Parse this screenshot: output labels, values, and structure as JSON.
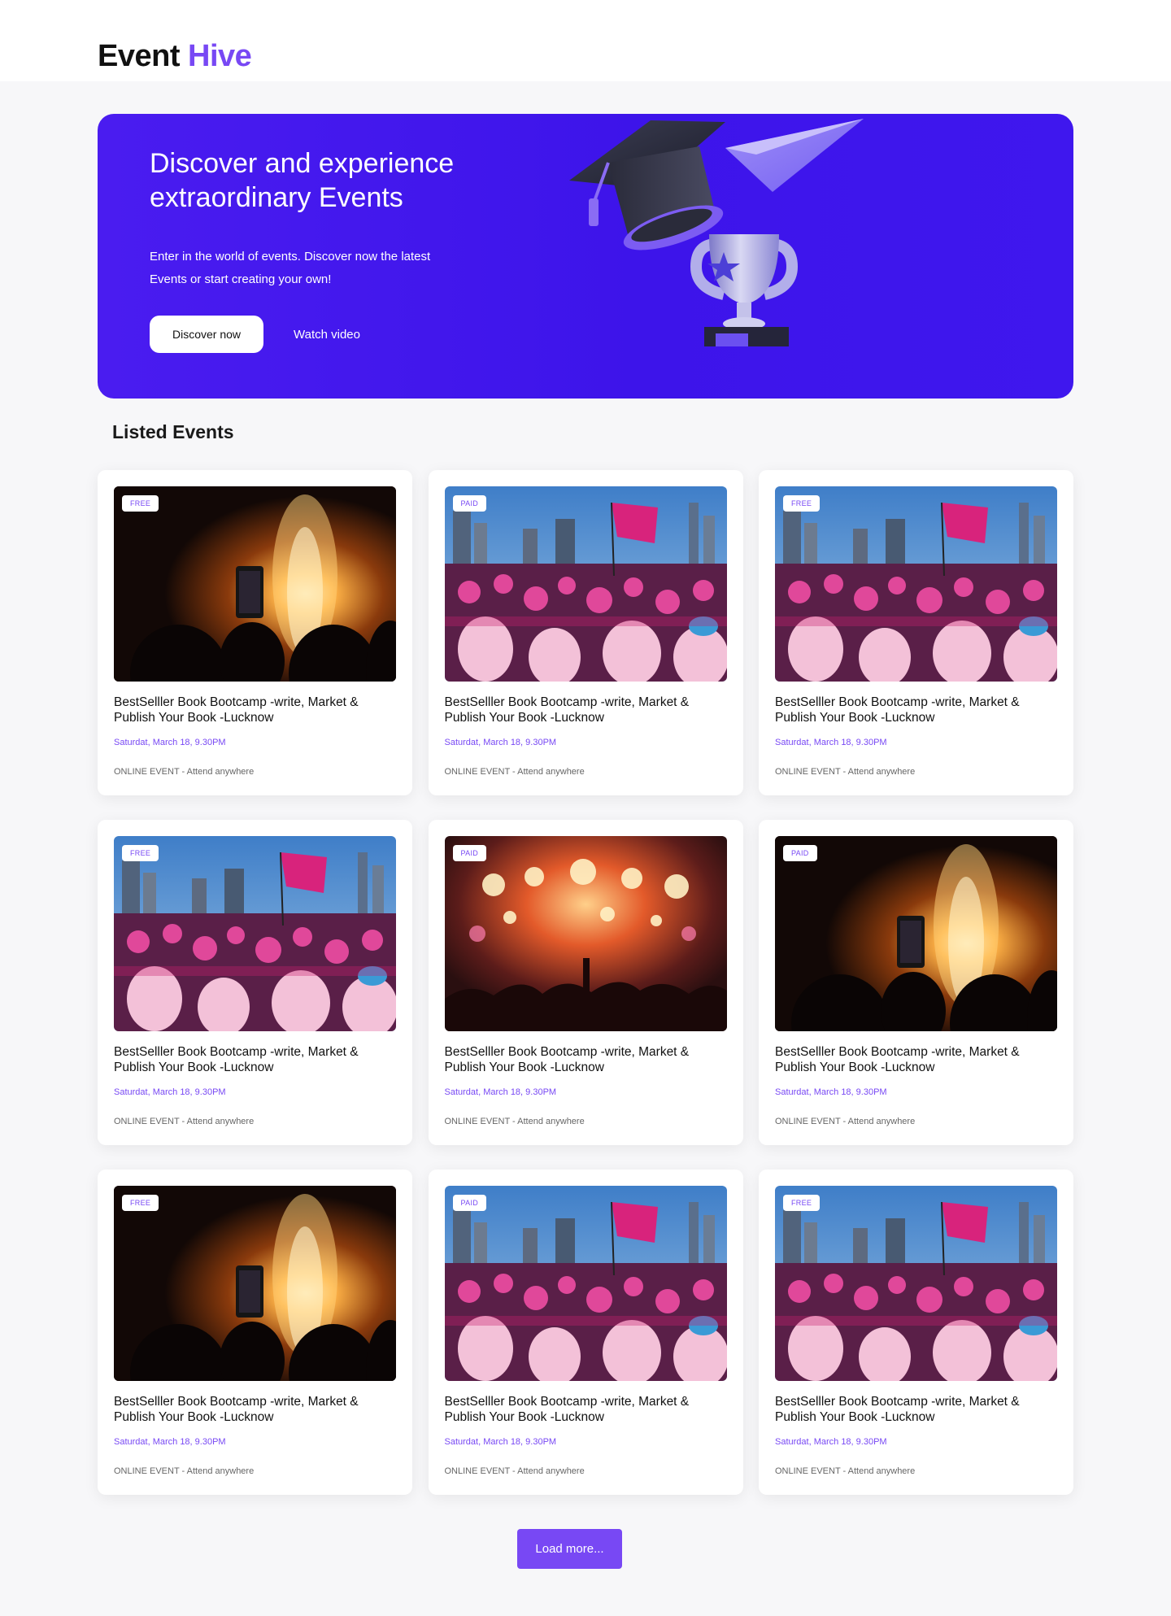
{
  "brand": {
    "name_part1": "Event",
    "name_part2": "Hive",
    "accent": "#7848f4"
  },
  "hero": {
    "title": "Discover and experience extraordinary Events",
    "subtitle": "Enter in the world of events. Discover now the latest Events or start creating your own!",
    "primary_button": "Discover now",
    "secondary_button": "Watch video",
    "background": "#4a1cf0"
  },
  "section": {
    "title": "Listed Events"
  },
  "events": [
    {
      "badge": "FREE",
      "image": "fireworks",
      "title": "BestSelller Book Bootcamp -write, Market & Publish Your Book -Lucknow",
      "date": "Saturdat, March 18, 9.30PM",
      "location": "ONLINE EVENT - Attend anywhere"
    },
    {
      "badge": "PAID",
      "image": "crowd",
      "title": "BestSelller Book Bootcamp -write, Market & Publish Your Book -Lucknow",
      "date": "Saturdat, March 18, 9.30PM",
      "location": "ONLINE EVENT - Attend anywhere"
    },
    {
      "badge": "FREE",
      "image": "crowd",
      "title": "BestSelller Book Bootcamp -write, Market & Publish Your Book -Lucknow",
      "date": "Saturdat, March 18, 9.30PM",
      "location": "ONLINE EVENT - Attend anywhere"
    },
    {
      "badge": "FREE",
      "image": "crowd",
      "title": "BestSelller Book Bootcamp -write, Market & Publish Your Book -Lucknow",
      "date": "Saturdat, March 18, 9.30PM",
      "location": "ONLINE EVENT - Attend anywhere"
    },
    {
      "badge": "PAID",
      "image": "concert",
      "title": "BestSelller Book Bootcamp -write, Market & Publish Your Book -Lucknow",
      "date": "Saturdat, March 18, 9.30PM",
      "location": "ONLINE EVENT - Attend anywhere"
    },
    {
      "badge": "PAID",
      "image": "fireworks",
      "title": "BestSelller Book Bootcamp -write, Market & Publish Your Book -Lucknow",
      "date": "Saturdat, March 18, 9.30PM",
      "location": "ONLINE EVENT - Attend anywhere"
    },
    {
      "badge": "FREE",
      "image": "fireworks",
      "title": "BestSelller Book Bootcamp -write, Market & Publish Your Book -Lucknow",
      "date": "Saturdat, March 18, 9.30PM",
      "location": "ONLINE EVENT - Attend anywhere"
    },
    {
      "badge": "PAID",
      "image": "crowd",
      "title": "BestSelller Book Bootcamp -write, Market & Publish Your Book -Lucknow",
      "date": "Saturdat, March 18, 9.30PM",
      "location": "ONLINE EVENT - Attend anywhere"
    },
    {
      "badge": "FREE",
      "image": "crowd",
      "title": "BestSelller Book Bootcamp -write, Market & Publish Your Book -Lucknow",
      "date": "Saturdat, March 18, 9.30PM",
      "location": "ONLINE EVENT - Attend anywhere"
    }
  ],
  "load_more": "Load more..."
}
